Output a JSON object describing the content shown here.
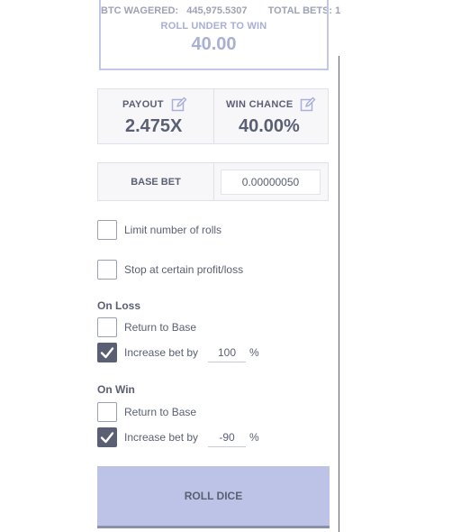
{
  "stats": {
    "btc_wagered_label": "BTC WAGERED:",
    "btc_wagered_value": "445,975.5307",
    "total_bets_label": "TOTAL BETS: 1"
  },
  "roll": {
    "label": "ROLL UNDER TO WIN",
    "value": "40.00"
  },
  "payout": {
    "label": "PAYOUT",
    "value": "2.475X",
    "icon": "edit-icon"
  },
  "win_chance": {
    "label": "WIN CHANCE",
    "value": "40.00%",
    "icon": "edit-icon"
  },
  "base_bet": {
    "label": "BASE BET",
    "value": "0.00000050"
  },
  "options": {
    "limit_rolls": {
      "label": "Limit number of rolls",
      "checked": false
    },
    "stop_profit": {
      "label": "Stop at certain profit/loss",
      "checked": false
    }
  },
  "on_loss": {
    "title": "On Loss",
    "return_label": "Return to Base",
    "return_checked": false,
    "increase_label": "Increase bet by",
    "increase_checked": true,
    "increase_value": "100",
    "percent": "%"
  },
  "on_win": {
    "title": "On Win",
    "return_label": "Return to Base",
    "return_checked": false,
    "increase_label": "Increase bet by",
    "increase_checked": true,
    "increase_value": "-90",
    "percent": "%"
  },
  "roll_button": {
    "label": "ROLL DICE"
  },
  "colors": {
    "accent": "#bcc3e6",
    "text": "#5a5f73",
    "muted": "#a9afd6"
  }
}
